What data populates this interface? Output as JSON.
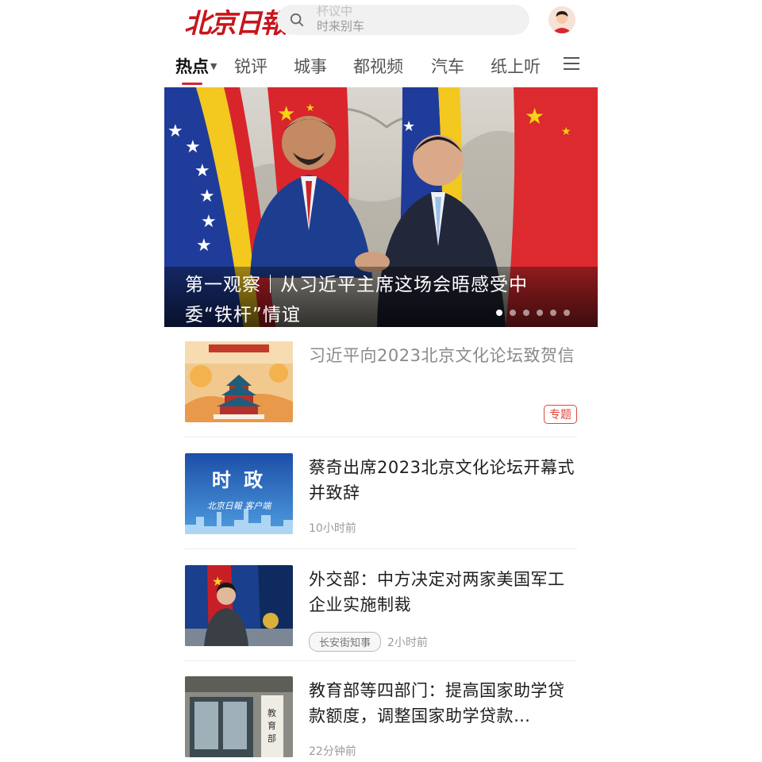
{
  "header": {
    "logo_text": "北京日報",
    "search_hint_prev": "杯议中",
    "search_hint": "时来别车",
    "avatar_icon": "user-avatar-icon"
  },
  "tabs": [
    {
      "label": "热点",
      "active": true
    },
    {
      "label": "锐评"
    },
    {
      "label": "城事"
    },
    {
      "label": "都视频"
    },
    {
      "label": "汽车"
    },
    {
      "label": "纸上听"
    }
  ],
  "tabs_more_icon": "menu-icon",
  "hero": {
    "title": "第一观察｜从习近平主席这场会晤感受中委“铁杆”情谊",
    "slide_count": 6,
    "active_slide": 1
  },
  "news": [
    {
      "title": "习近平向2023北京文化论坛致贺信",
      "badge": "专题",
      "read": true
    },
    {
      "title": "蔡奇出席2023北京文化论坛开幕式并致辞",
      "thumb_text": "时  政",
      "thumb_sub": "北京日報 客户端",
      "time": "10小时前"
    },
    {
      "title": "外交部：中方决定对两家美国军工企业实施制裁",
      "tag": "长安街知事",
      "time": "2小时前"
    },
    {
      "title": "教育部等四部门：提高国家助学贷款额度，调整国家助学贷款…",
      "time": "22分钟前"
    }
  ],
  "colors": {
    "brand_red": "#c8161d",
    "accent_red": "#d4242b",
    "text": "#1e1e1e",
    "muted": "#9b9b9b"
  }
}
